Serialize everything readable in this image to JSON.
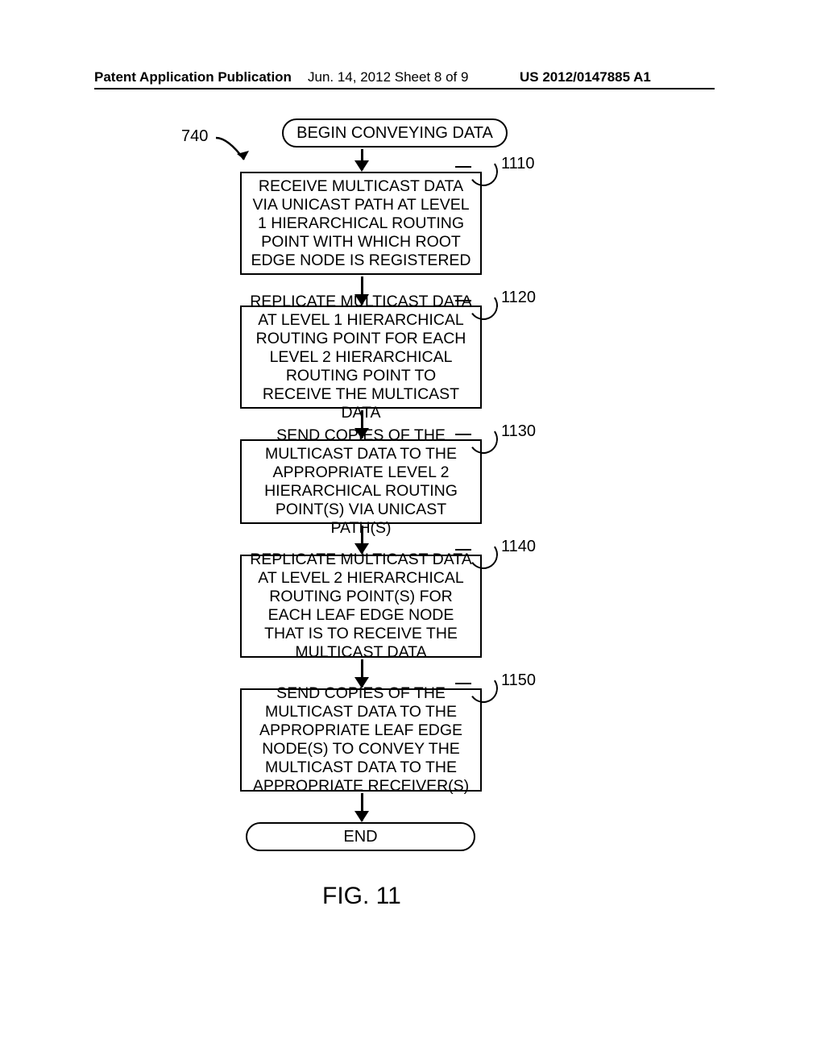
{
  "header": {
    "left": "Patent Application Publication",
    "mid": "Jun. 14, 2012  Sheet 8 of 9",
    "right": "US 2012/0147885 A1"
  },
  "diagram": {
    "label_740": "740",
    "begin": "BEGIN CONVEYING DATA",
    "step1": {
      "ref": "1110",
      "text": "RECEIVE MULTICAST DATA VIA UNICAST PATH AT LEVEL 1 HIERARCHICAL ROUTING POINT WITH WHICH ROOT EDGE NODE IS REGISTERED"
    },
    "step2": {
      "ref": "1120",
      "text": "REPLICATE MULTICAST DATA AT LEVEL 1 HIERARCHICAL ROUTING POINT FOR EACH LEVEL 2 HIERARCHICAL ROUTING POINT TO RECEIVE THE MULTICAST DATA"
    },
    "step3": {
      "ref": "1130",
      "text": "SEND COPIES OF THE MULTICAST DATA TO THE APPROPRIATE LEVEL 2 HIERARCHICAL ROUTING POINT(S) VIA UNICAST PATH(S)"
    },
    "step4": {
      "ref": "1140",
      "text": "REPLICATE MULTICAST DATA AT LEVEL 2 HIERARCHICAL ROUTING POINT(S) FOR EACH LEAF EDGE NODE THAT IS TO RECEIVE THE MULTICAST DATA"
    },
    "step5": {
      "ref": "1150",
      "text": "SEND COPIES OF THE MULTICAST DATA TO THE APPROPRIATE LEAF EDGE NODE(S) TO CONVEY THE MULTICAST DATA TO THE APPROPRIATE RECEIVER(S)"
    },
    "end": "END",
    "figure": "FIG. 11"
  }
}
